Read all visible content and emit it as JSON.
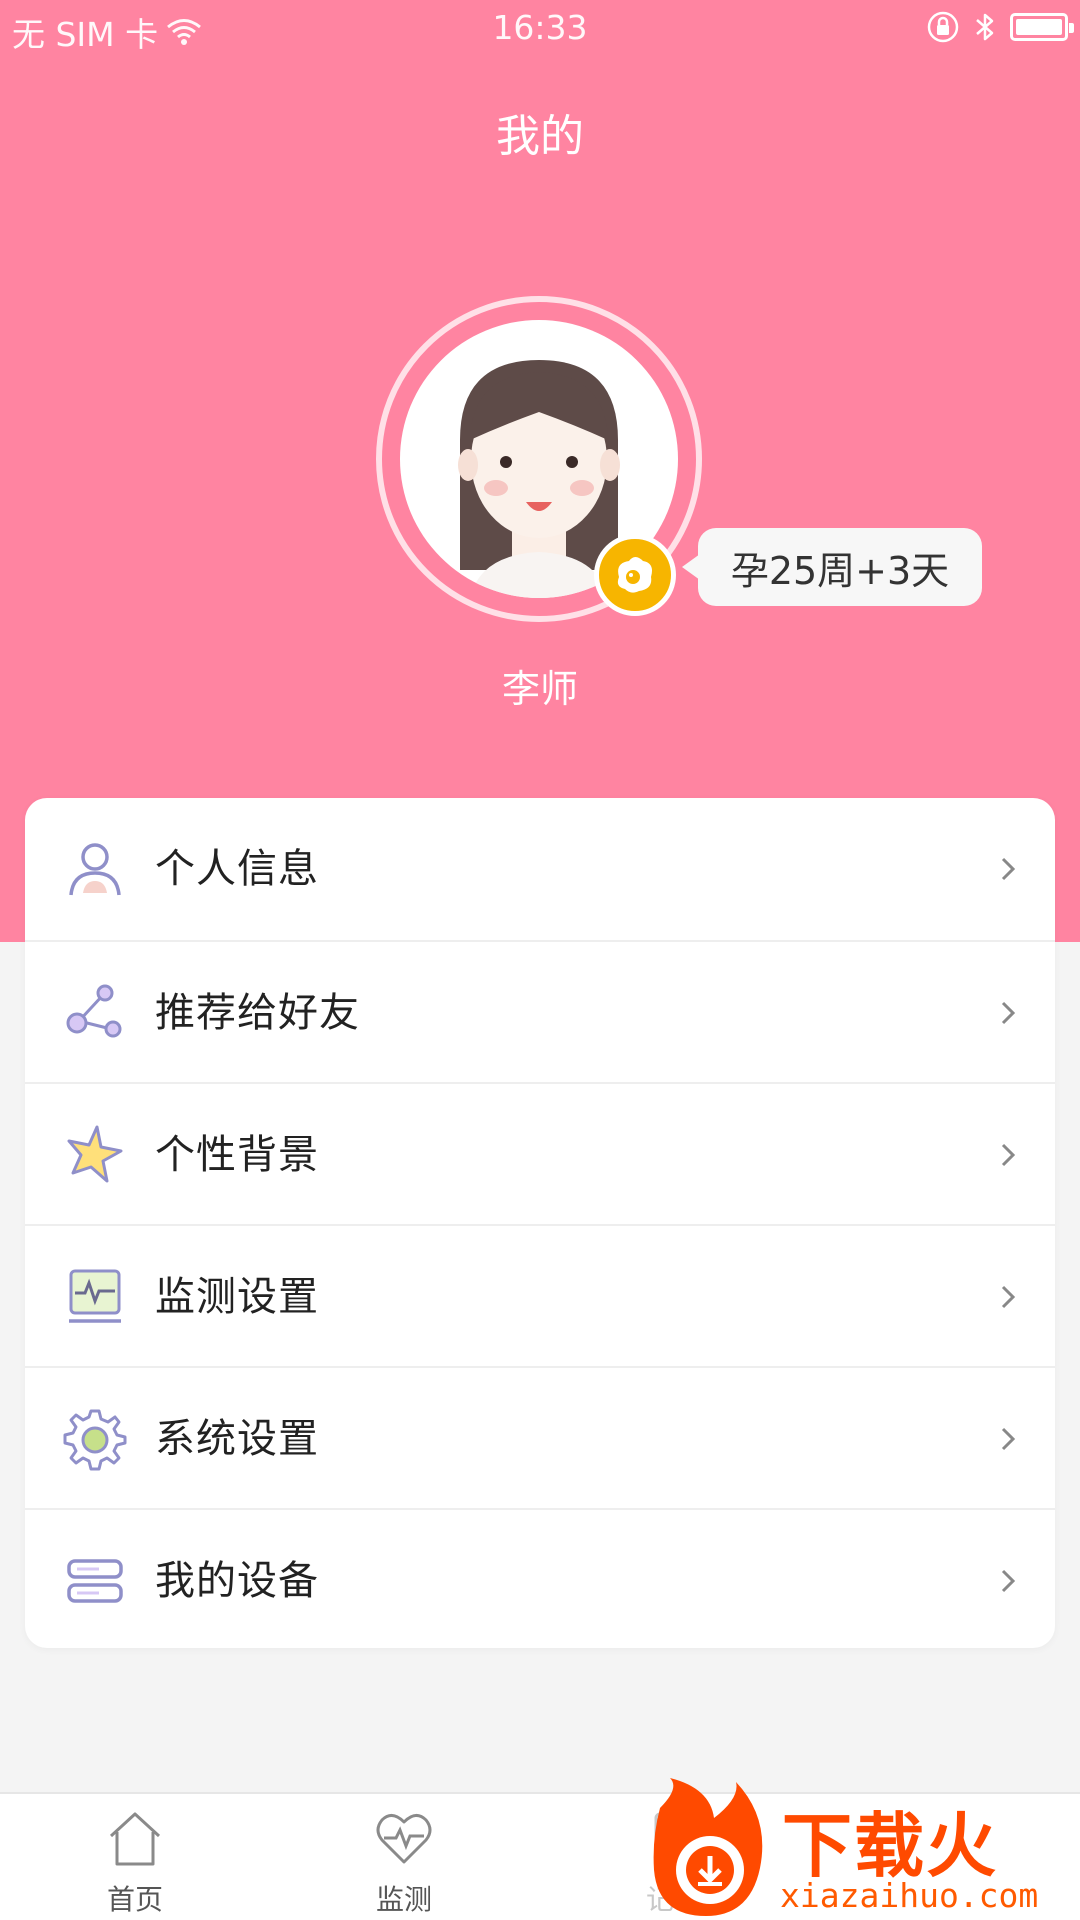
{
  "status_bar": {
    "carrier": "无 SIM 卡",
    "time": "16:33"
  },
  "header": {
    "title": "我的"
  },
  "profile": {
    "pregnancy": "孕25周+3天",
    "name": "李师"
  },
  "menu": {
    "items": [
      {
        "label": "个人信息",
        "icon": "person-icon"
      },
      {
        "label": "推荐给好友",
        "icon": "share-icon"
      },
      {
        "label": "个性背景",
        "icon": "star-icon"
      },
      {
        "label": "监测设置",
        "icon": "monitor-icon"
      },
      {
        "label": "系统设置",
        "icon": "gear-icon"
      },
      {
        "label": "我的设备",
        "icon": "device-icon"
      }
    ]
  },
  "tabbar": {
    "items": [
      {
        "label": "首页",
        "icon": "home-icon"
      },
      {
        "label": "监测",
        "icon": "heart-pulse-icon"
      },
      {
        "label": "记录",
        "icon": "record-icon"
      }
    ]
  },
  "watermark": {
    "title": "下载火",
    "url": "xiazaihuo.com"
  },
  "colors": {
    "header_pink": "#ff84a1",
    "badge_yellow": "#f7b500",
    "icon_purple": "#8f8fc9",
    "icon_green": "#c6e08a"
  }
}
